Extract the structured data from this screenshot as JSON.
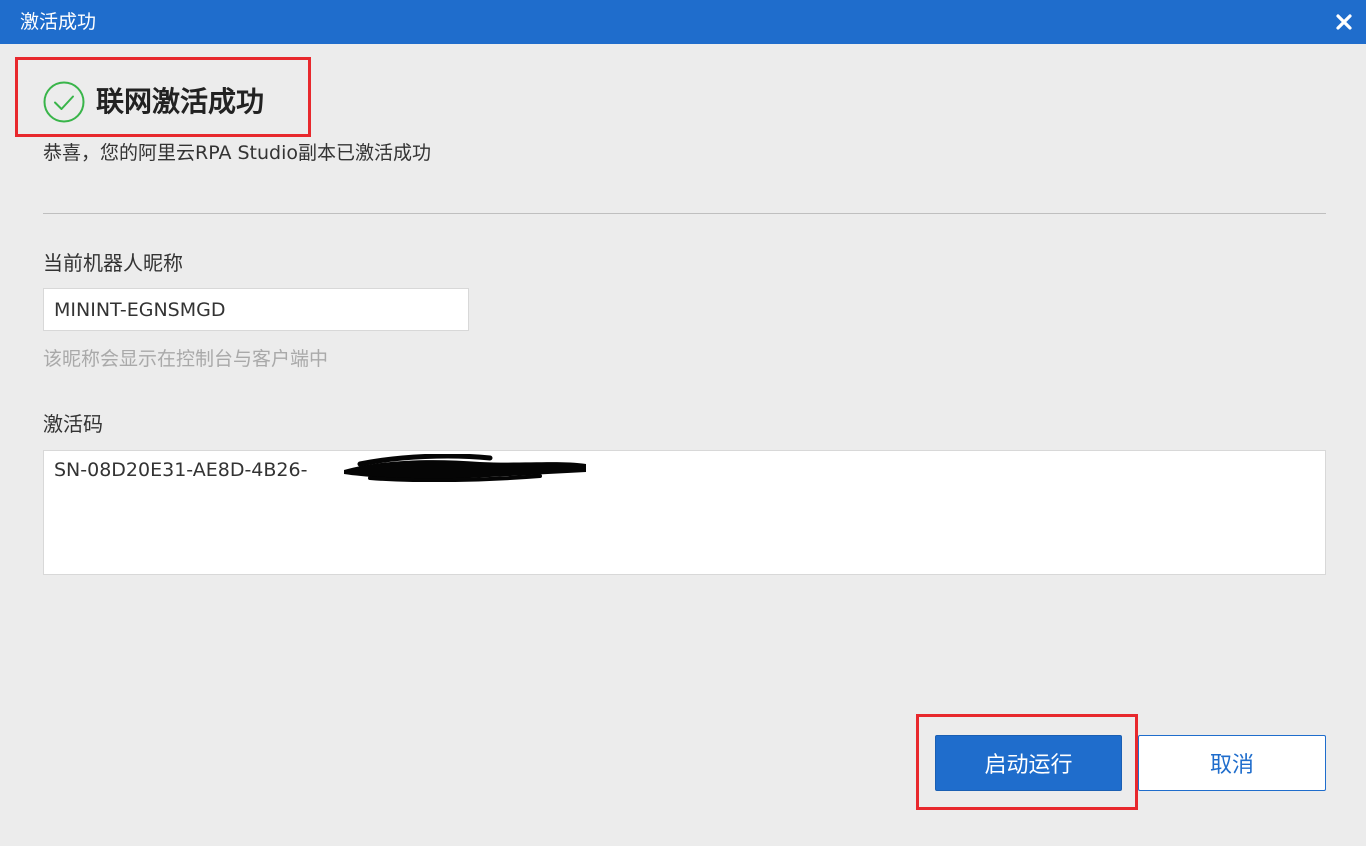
{
  "window": {
    "title": "激活成功"
  },
  "result": {
    "heading": "联网激活成功",
    "message": "恭喜，您的阿里云RPA Studio副本已激活成功"
  },
  "robot_name": {
    "label": "当前机器人昵称",
    "value": "MININT-EGNSMGD",
    "hint": "该昵称会显示在控制台与客户端中"
  },
  "activation_code": {
    "label": "激活码",
    "value": "SN-08D20E31-AE8D-4B26-"
  },
  "buttons": {
    "start_label": "启动运行",
    "cancel_label": "取消"
  },
  "colors": {
    "titlebar": "#1f6dcc",
    "success_icon": "#39b54a",
    "annotation": "#e8282d"
  },
  "icons": {
    "close": "close-icon",
    "success": "check-circle-icon"
  }
}
